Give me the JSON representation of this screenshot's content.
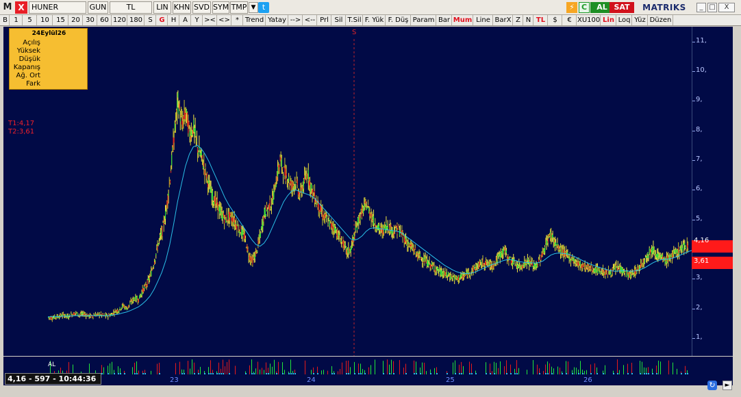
{
  "titlebar": {
    "app_mark": "M",
    "close_label": "X",
    "symbol": "HUNER",
    "period": "GUN",
    "currency": "TL",
    "scale": "LIN",
    "khn": "KHN",
    "svd": "SVD",
    "sym": "SYM",
    "tmp": "TMP",
    "dropdown": "▼",
    "twitter": "t",
    "bolt": "⚡",
    "c_label": "C",
    "buy_label": "AL",
    "sell_label": "SAT",
    "brand": "MATRIKS",
    "win_min": "_",
    "win_max": "□",
    "win_close": "X"
  },
  "toolbar": {
    "items": [
      "B",
      "1",
      "5",
      "10",
      "15",
      "20",
      "30",
      "60",
      "120",
      "180",
      "S",
      "G",
      "H",
      "A",
      "Y",
      "><",
      "<>",
      "*",
      "Trend",
      "Yatay",
      "-->",
      "<--",
      "Prl",
      "Sil",
      "T.Sil",
      "F. Yük",
      "F. Düş",
      "Param",
      "Bar",
      "Mum",
      "Line",
      "BarX",
      "Z",
      "N",
      "TL",
      "$",
      "€",
      "XU100",
      "Lin",
      "Loq",
      "Yüz",
      "Düzen"
    ],
    "red_items": [
      "G",
      "Mum",
      "TL",
      "Lin"
    ]
  },
  "infobox": {
    "date": "24Eylül26",
    "rows": [
      "Açılış",
      "Yüksek",
      "Düşük",
      "Kapanış",
      "Ağ. Ort",
      "Fark"
    ]
  },
  "levels": {
    "t1": "T1:4,17",
    "t2": "T2:3,61"
  },
  "session_marker": "S",
  "axis": {
    "ticks": [
      "11,",
      "10,",
      "9,",
      "8,",
      "7,",
      "6,",
      "5,",
      "4,",
      "3,",
      "2,",
      "1,"
    ]
  },
  "price_tags": {
    "current": "4,16",
    "support": "3,61"
  },
  "status": {
    "text": "4,16 - 597 - 10:44:36"
  },
  "volume": {
    "label": "AL"
  },
  "dates": [
    "23",
    "24",
    "25",
    "26"
  ],
  "colors": {
    "background": "#010a46",
    "up_candle": "#22e83a",
    "down_candle": "#e81a1a",
    "high_tint": "#f2e640",
    "moving_average": "#2ac0e8",
    "trend_line": "#ff1a1a",
    "infobox": "#f6be31"
  },
  "chart_data": {
    "type": "line",
    "title": "",
    "xlabel": "",
    "ylabel": "",
    "ylim": [
      0.4,
      11.5
    ],
    "x_ticks": [
      "23",
      "24",
      "25",
      "26"
    ],
    "series": [
      {
        "values": [
          1.7,
          1.68,
          1.72,
          1.75,
          1.78,
          1.72,
          1.8,
          1.85,
          1.78,
          1.82,
          1.76,
          1.74,
          1.78,
          1.8,
          1.76,
          1.75,
          1.79,
          1.9,
          1.95,
          2.1,
          2.0,
          2.2,
          2.35,
          2.3,
          2.6,
          2.8,
          3.1,
          3.6,
          4.2,
          4.6,
          5.3,
          6.4,
          7.8,
          9.0,
          8.2,
          8.6,
          7.9,
          8.1,
          7.4,
          7.1,
          6.6,
          6.1,
          5.7,
          5.5,
          5.2,
          5.0,
          5.1,
          5.0,
          4.8,
          4.6,
          4.4,
          3.8,
          3.6,
          3.9,
          4.5,
          5.2,
          5.4,
          5.6,
          6.3,
          7.0,
          6.6,
          6.4,
          6.1,
          6.3,
          5.8,
          6.2,
          6.6,
          6.0,
          5.7,
          5.4,
          5.1,
          5.0,
          4.8,
          4.7,
          4.4,
          4.2,
          3.9,
          4.0,
          4.5,
          5.0,
          5.3,
          5.5,
          5.2,
          4.9,
          4.7,
          4.6,
          4.8,
          4.7,
          4.6,
          4.7,
          4.5,
          4.3,
          4.1,
          4.0,
          3.8,
          3.7,
          3.6,
          3.5,
          3.4,
          3.3,
          3.2,
          3.15,
          3.1,
          3.05,
          3.0,
          3.05,
          3.1,
          3.2,
          3.3,
          3.4,
          3.5,
          3.55,
          3.5,
          3.45,
          3.6,
          3.8,
          4.0,
          3.7,
          3.6,
          3.5,
          3.4,
          3.5,
          3.6,
          3.5,
          3.4,
          3.6,
          3.9,
          4.3,
          4.5,
          4.2,
          4.0,
          3.9,
          3.8,
          3.7,
          3.6,
          3.5,
          3.45,
          3.4,
          3.35,
          3.3,
          3.3,
          3.25,
          3.2,
          3.2,
          3.3,
          3.4,
          3.3,
          3.2,
          3.1,
          3.2,
          3.3,
          3.5,
          3.7,
          3.9,
          4.0,
          3.8,
          3.7,
          3.6,
          3.7,
          3.8,
          3.9,
          4.0,
          4.1,
          4.16
        ]
      },
      {
        "values": [
          1.72,
          1.72,
          1.72,
          1.73,
          1.74,
          1.74,
          1.75,
          1.76,
          1.76,
          1.76,
          1.76,
          1.76,
          1.76,
          1.76,
          1.76,
          1.76,
          1.77,
          1.79,
          1.81,
          1.85,
          1.88,
          1.93,
          1.99,
          2.05,
          2.15,
          2.27,
          2.42,
          2.64,
          2.92,
          3.22,
          3.62,
          4.15,
          4.85,
          5.6,
          6.2,
          6.8,
          7.2,
          7.45,
          7.5,
          7.4,
          7.2,
          6.95,
          6.65,
          6.35,
          6.05,
          5.75,
          5.5,
          5.3,
          5.1,
          4.9,
          4.7,
          4.5,
          4.3,
          4.15,
          4.1,
          4.2,
          4.4,
          4.7,
          5.0,
          5.3,
          5.6,
          5.8,
          5.95,
          6.0,
          5.95,
          5.9,
          5.85,
          5.8,
          5.7,
          5.55,
          5.4,
          5.25,
          5.1,
          4.95,
          4.8,
          4.65,
          4.5,
          4.35,
          4.3,
          4.35,
          4.45,
          4.6,
          4.7,
          4.72,
          4.7,
          4.68,
          4.66,
          4.64,
          4.62,
          4.6,
          4.55,
          4.45,
          4.35,
          4.25,
          4.15,
          4.05,
          3.95,
          3.85,
          3.75,
          3.65,
          3.55,
          3.45,
          3.38,
          3.3,
          3.24,
          3.2,
          3.18,
          3.18,
          3.2,
          3.24,
          3.3,
          3.36,
          3.42,
          3.48,
          3.52,
          3.57,
          3.62,
          3.65,
          3.65,
          3.62,
          3.58,
          3.56,
          3.55,
          3.54,
          3.53,
          3.55,
          3.6,
          3.7,
          3.8,
          3.85,
          3.87,
          3.86,
          3.84,
          3.8,
          3.75,
          3.69,
          3.62,
          3.56,
          3.5,
          3.45,
          3.4,
          3.36,
          3.32,
          3.28,
          3.26,
          3.26,
          3.27,
          3.27,
          3.26,
          3.26,
          3.28,
          3.32,
          3.38,
          3.46,
          3.54,
          3.6,
          3.64,
          3.66,
          3.67,
          3.7,
          3.74,
          3.8,
          3.86,
          3.92,
          3.96
        ]
      }
    ],
    "trend_lines": [
      {
        "from": [
          179,
          4.36
        ],
        "to": [
          198,
          4.17
        ]
      },
      {
        "from": [
          170,
          2.9
        ],
        "to": [
          199,
          3.61
        ]
      }
    ]
  }
}
